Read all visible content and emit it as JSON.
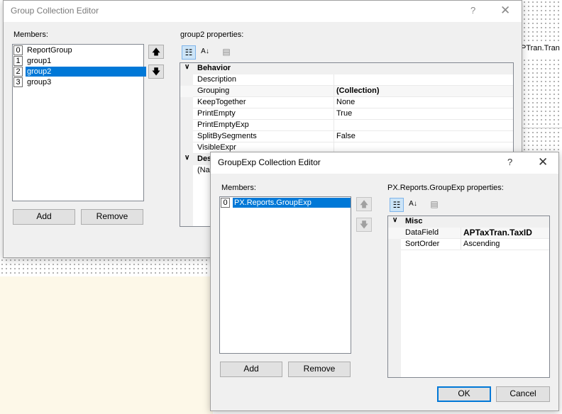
{
  "background": {
    "fragment_text": "PTran.Tran"
  },
  "group_editor": {
    "title": "Group Collection Editor",
    "help": "?",
    "close": "✕",
    "members_label": "Members:",
    "members": [
      {
        "index": "0",
        "name": "ReportGroup",
        "selected": false
      },
      {
        "index": "1",
        "name": "group1",
        "selected": false
      },
      {
        "index": "2",
        "name": "group2",
        "selected": true
      },
      {
        "index": "3",
        "name": "group3",
        "selected": false
      }
    ],
    "add_label": "Add",
    "remove_label": "Remove",
    "props_label": "group2 properties:",
    "categories": [
      {
        "name": "Behavior",
        "rows": [
          {
            "name": "Description",
            "value": ""
          },
          {
            "name": "Grouping",
            "value": "(Collection)",
            "bold": true
          },
          {
            "name": "KeepTogether",
            "value": "None"
          },
          {
            "name": "PrintEmpty",
            "value": "True"
          },
          {
            "name": "PrintEmptyExp",
            "value": ""
          },
          {
            "name": "SplitBySegments",
            "value": "False"
          },
          {
            "name": "VisibleExpr",
            "value": ""
          }
        ]
      },
      {
        "name": "Des",
        "rows": [
          {
            "name": "(Na",
            "value": ""
          }
        ]
      }
    ]
  },
  "groupexp_editor": {
    "title": "GroupExp Collection Editor",
    "help": "?",
    "close": "✕",
    "members_label": "Members:",
    "members": [
      {
        "index": "0",
        "name": "PX.Reports.GroupExp",
        "selected": true
      }
    ],
    "add_label": "Add",
    "remove_label": "Remove",
    "props_label": "PX.Reports.GroupExp properties:",
    "categories": [
      {
        "name": "Misc",
        "rows": [
          {
            "name": "DataField",
            "value": "APTaxTran.TaxID",
            "bold": true
          },
          {
            "name": "SortOrder",
            "value": "Ascending"
          }
        ]
      }
    ],
    "ok_label": "OK",
    "cancel_label": "Cancel"
  },
  "icons": {
    "up": "🡅",
    "down": "🡇",
    "categorized": "☷",
    "alphabetical": "A↓",
    "property_pages": "▤",
    "chevron": "∨"
  }
}
